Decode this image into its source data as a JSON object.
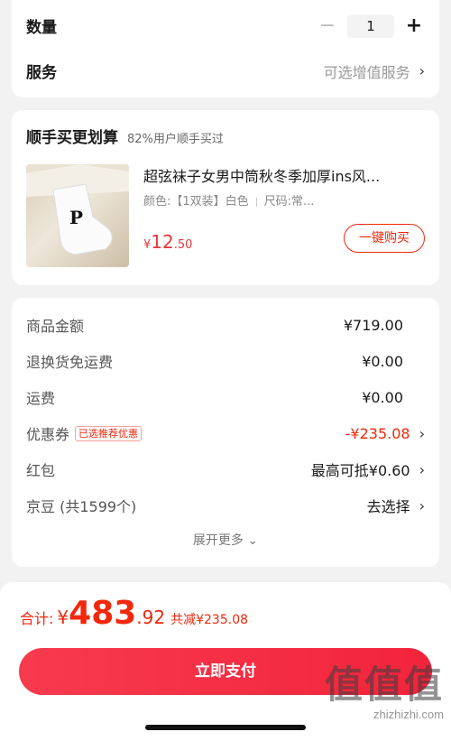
{
  "quantity": {
    "label": "数量",
    "minus": "−",
    "value": "1",
    "plus": "+"
  },
  "service": {
    "label": "服务",
    "value": "可选增值服务"
  },
  "recommend": {
    "title": "顺手买更划算",
    "subtitle": "82%用户顺手买过",
    "product": {
      "name": "超弦袜子女男中筒秋冬季加厚ins风...",
      "spec_color": "颜色:【1双装】白色",
      "spec_size": "尺码:常...",
      "price_symbol": "¥",
      "price_int": "12",
      "price_dec": ".50",
      "image_letter": "P"
    },
    "buy_button": "一键购买"
  },
  "summary": {
    "rows": [
      {
        "label": "商品金额",
        "value": "¥719.00"
      },
      {
        "label": "退换货免运费",
        "value": "¥0.00"
      },
      {
        "label": "运费",
        "value": "¥0.00"
      },
      {
        "label": "优惠券",
        "tag": "已选推荐优惠",
        "value": "-¥235.08"
      },
      {
        "label": "红包",
        "value": "最高可抵¥0.60"
      },
      {
        "label": "京豆 (共1599个)",
        "value": "去选择"
      }
    ],
    "expand": "展开更多 ⌄"
  },
  "footer": {
    "total_label": "合计:",
    "total_symbol": "¥",
    "total_int": "483",
    "total_dec": ".92",
    "discount": "共减¥235.08",
    "pay_button": "立即支付"
  },
  "watermark": {
    "logo": "值值值",
    "text": "zhizhizhi.com"
  },
  "icons": {
    "chevron": "chevron-right-icon"
  },
  "colors": {
    "accent": "#f2270c",
    "pay_button": "#f2243c"
  }
}
